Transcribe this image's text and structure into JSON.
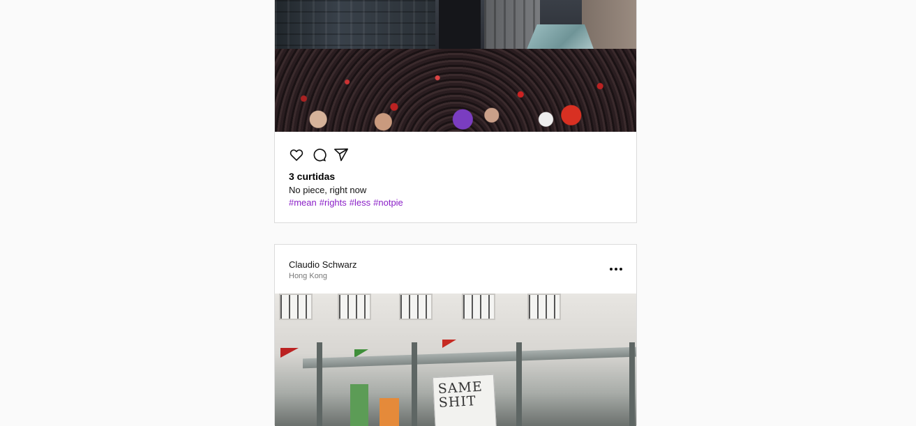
{
  "post1": {
    "likes": "3 curtidas",
    "caption": "No piece, right now",
    "hashtags": [
      "#mean",
      "#rights",
      "#less",
      "#notpie"
    ],
    "actions": {
      "like_icon": "heart-icon",
      "comment_icon": "comment-icon",
      "share_icon": "send-icon"
    }
  },
  "post2": {
    "username": "Claudio Schwarz",
    "location": "Hong Kong",
    "more_icon": "more-options-icon",
    "sign_text": "SAME SHIT"
  },
  "colors": {
    "hashtag": "#8a1fc7",
    "background": "#fafafa",
    "border": "#dbdbdb"
  }
}
